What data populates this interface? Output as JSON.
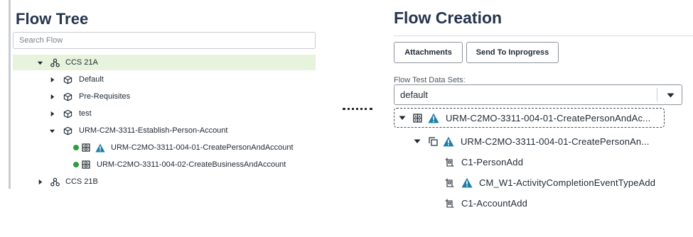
{
  "flow_tree": {
    "title": "Flow Tree",
    "search_placeholder": "Search Flow",
    "items": [
      {
        "label": "CCS 21A"
      },
      {
        "label": "Default"
      },
      {
        "label": "Pre-Requisites"
      },
      {
        "label": "test"
      },
      {
        "label": "URM-C2M-3311-Establish-Person-Account"
      },
      {
        "label": "URM-C2MO-3311-004-01-CreatePersonAndAccount"
      },
      {
        "label": "URM-C2MO-3311-004-02-CreateBusinessAndAccount"
      },
      {
        "label": "CCS 21B"
      }
    ]
  },
  "flow_creation": {
    "title": "Flow Creation",
    "buttons": {
      "attachments": "Attachments",
      "send_to_inprogress": "Send To Inprogress"
    },
    "data_sets_label": "Flow Test Data Sets:",
    "data_set_selected": "default",
    "tree": [
      {
        "label": "URM-C2MO-3311-004-01-CreatePersonAndAc..."
      },
      {
        "label": "URM-C2MO-3311-004-01-CreatePersonAn..."
      },
      {
        "label": "C1-PersonAdd"
      },
      {
        "label": "CM_W1-ActivityCompletionEventTypeAdd"
      },
      {
        "label": "C1-AccountAdd"
      }
    ]
  },
  "colors": {
    "selected_row": "#e7f3dc",
    "status_dot": "#2e9e3e",
    "warning": "#1f7ea8",
    "title": "#26354d"
  },
  "icons": [
    "caret-down-icon",
    "caret-right-icon",
    "hierarchy-icon",
    "cube-icon",
    "grid-icon",
    "warning-icon",
    "copy-icon",
    "component-icon"
  ]
}
